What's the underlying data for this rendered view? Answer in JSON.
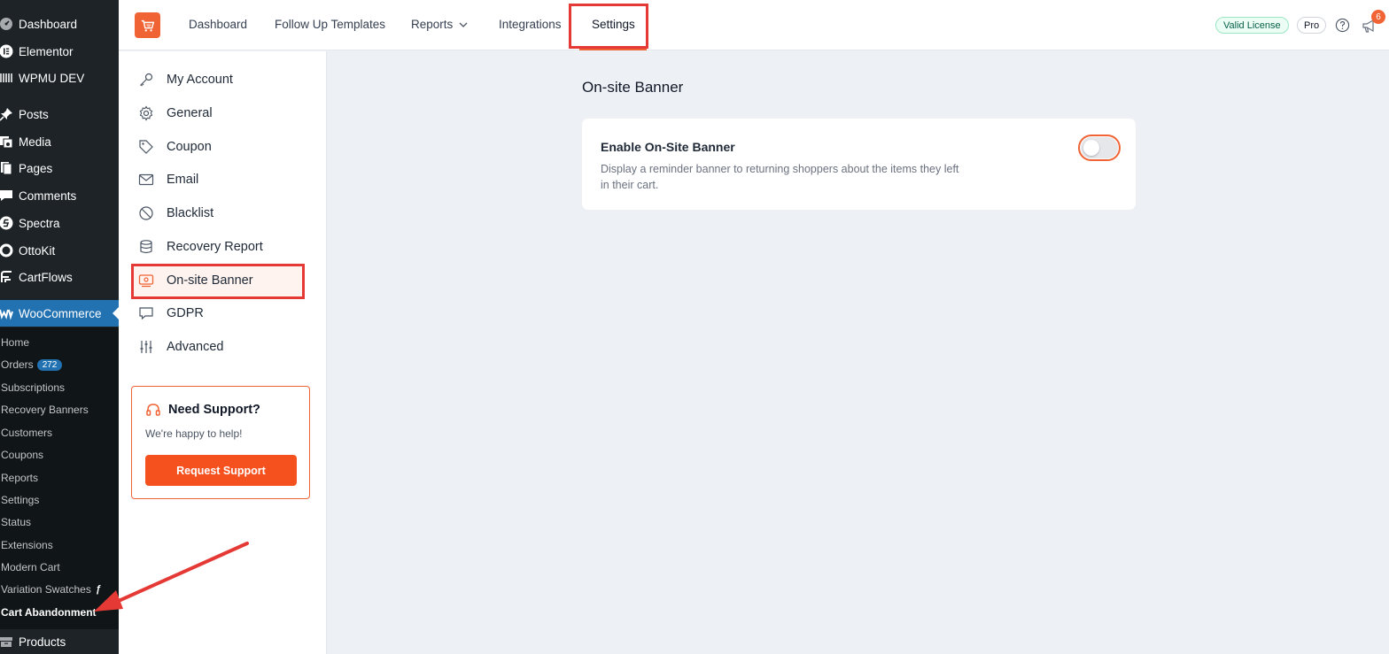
{
  "wp_menu": {
    "top_items": [
      {
        "label": "Dashboard",
        "icon": "dashboard-icon"
      },
      {
        "label": "Elementor",
        "icon": "elementor-icon"
      },
      {
        "label": "WPMU DEV",
        "icon": "wpmudev-icon"
      },
      {
        "label": "Posts",
        "icon": "pin-icon"
      },
      {
        "label": "Media",
        "icon": "media-icon"
      },
      {
        "label": "Pages",
        "icon": "pages-icon"
      },
      {
        "label": "Comments",
        "icon": "comment-icon"
      },
      {
        "label": "Spectra",
        "icon": "spectra-icon"
      },
      {
        "label": "OttoKit",
        "icon": "ottokit-icon"
      },
      {
        "label": "CartFlows",
        "icon": "cartflows-icon"
      },
      {
        "label": "WooCommerce",
        "icon": "woocommerce-icon"
      }
    ],
    "woocommerce_sub": [
      {
        "label": "Home"
      },
      {
        "label": "Orders",
        "badge": "272"
      },
      {
        "label": "Subscriptions"
      },
      {
        "label": "Recovery Banners"
      },
      {
        "label": "Customers"
      },
      {
        "label": "Coupons"
      },
      {
        "label": "Reports"
      },
      {
        "label": "Settings"
      },
      {
        "label": "Status"
      },
      {
        "label": "Extensions"
      },
      {
        "label": "Modern Cart"
      },
      {
        "label": "Variation Swatches"
      },
      {
        "label": "Cart Abandonment"
      }
    ],
    "products_label": "Products"
  },
  "header": {
    "nav": [
      "Dashboard",
      "Follow Up Templates",
      "Reports",
      "Integrations",
      "Settings"
    ],
    "active_nav": "Settings",
    "license_badge": "Valid License",
    "plan_badge": "Pro",
    "notifications_count": "6",
    "accent_color": "#f06335"
  },
  "settings_menu": {
    "items": [
      {
        "label": "My Account",
        "icon": "key-icon"
      },
      {
        "label": "General",
        "icon": "gear-icon"
      },
      {
        "label": "Coupon",
        "icon": "tag-icon"
      },
      {
        "label": "Email",
        "icon": "envelope-icon"
      },
      {
        "label": "Blacklist",
        "icon": "block-icon"
      },
      {
        "label": "Recovery Report",
        "icon": "database-icon"
      },
      {
        "label": "On-site Banner",
        "icon": "banner-icon"
      },
      {
        "label": "GDPR",
        "icon": "chat-bubble-icon"
      },
      {
        "label": "Advanced",
        "icon": "sliders-icon"
      }
    ],
    "active_item": "On-site Banner"
  },
  "support": {
    "title": "Need Support?",
    "subtitle": "We're happy to help!",
    "button": "Request Support"
  },
  "main": {
    "title": "On-site Banner",
    "setting_label": "Enable On-Site Banner",
    "setting_description": "Display a reminder banner to returning shoppers about the items they left in their cart.",
    "toggle_enabled": false
  }
}
